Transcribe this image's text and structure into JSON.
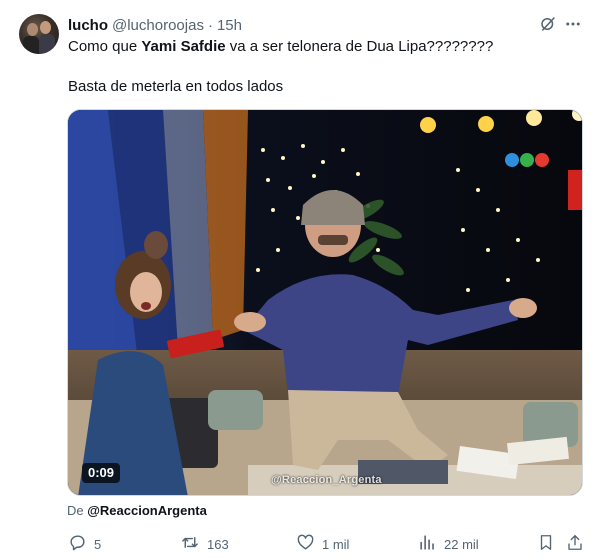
{
  "tweet": {
    "author_name": "lucho",
    "author_handle": "@luchoroojas",
    "separator": "·",
    "time": "15h",
    "text_line1_pre": "Como que ",
    "text_line1_bold": "Yami Safdie",
    "text_line1_post": " va a ser telonera de Dua Lipa????????",
    "text_line2": "Basta de meterla en todos lados"
  },
  "media": {
    "duration": "0:09",
    "watermark": "@Reaccion_Argenta"
  },
  "attribution": {
    "prefix": "De ",
    "account": "@ReaccionArgenta"
  },
  "actions": {
    "replies": "5",
    "retweets": "163",
    "likes": "1 mil",
    "views": "22 mil"
  },
  "icons": {
    "grok": "grok-icon",
    "more": "more-icon",
    "reply": "reply-icon",
    "retweet": "retweet-icon",
    "like": "heart-icon",
    "views": "views-icon",
    "bookmark": "bookmark-icon",
    "share": "share-icon"
  },
  "colors": {
    "text_primary": "#0f1419",
    "text_secondary": "#536471",
    "border": "#cfd9de"
  }
}
